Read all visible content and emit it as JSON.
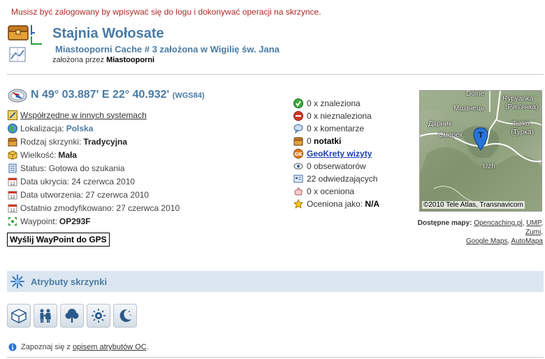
{
  "notice": "Musisz być zalogowany by wpisywać się do logu i dokonywać operacji na skrzynce.",
  "cache": {
    "title": "Stajnia Wołosate",
    "subtitle": "Miastooporni Cache # 3 założona w Wigilię św. Jana",
    "owner_prefix": "założona przez",
    "owner": "Miastooporni"
  },
  "coordinates": {
    "text": "N 49° 03.887' E 22° 40.932'",
    "datum": "(WGS84)"
  },
  "details": {
    "other_systems_link": "Współrzędne w innych systemach",
    "location_label": "Lokalizacja:",
    "location_value": "Polska",
    "type_label": "Rodzaj skrzynki:",
    "type_value": "Tradycyjna",
    "size_label": "Wielkość:",
    "size_value": "Mała",
    "status": "Status: Gotowa do szukania",
    "hidden": "Data ukrycia: 24 czerwca 2010",
    "created": "Data utworzenia: 27 czerwca 2010",
    "modified": "Ostatnio zmodyfikowano: 27 czerwca 2010",
    "waypoint_label": "Waypoint:",
    "waypoint_value": "OP293F",
    "gps_button": "Wyślij WayPoint do GPS"
  },
  "stats": {
    "found": "0 x znaleziona",
    "not_found": "0 x nieznaleziona",
    "comments": "0 x komentarze",
    "notes_count": "0",
    "notes_label": "notatki",
    "geokrety": "GeoKrety wizyty",
    "watchers": "0 obserwatorów",
    "visitors": "22 odwiedzających",
    "ratings": "0 x oceniona",
    "rated_as_label": "Oceniona jako:",
    "rated_as_value": "N/A"
  },
  "map": {
    "labels": {
      "dolne": "Dolne",
      "rypyanka": "Rypyanka",
      "rypianka": "(Рип'янка)",
      "mshanets": "Мшанець",
      "dvernik": "Дврник",
      "turka": "Turka",
      "turka_cyr": "(Турка)",
      "smerek": "Смерек",
      "uzh": "Uzh"
    },
    "marker_letter": "T",
    "credit": "©2010 Tele Atlas, Transnavicom",
    "available_label": "Dostępne mapy:",
    "links": [
      "Opencaching.pl",
      "UMP",
      "Zumi",
      "Google Maps",
      "AutoMapa"
    ]
  },
  "attributes": {
    "title": "Atrybuty skrzynki",
    "icons": [
      "box-attribute-icon",
      "family-attribute-icon",
      "tree-attribute-icon",
      "wellness-attribute-icon",
      "night-attribute-icon"
    ],
    "note_prefix": "Zapoznaj się z",
    "note_link": "opisem atrybutów OC",
    "note_suffix": "."
  },
  "colors": {
    "accent": "#4a7ba4",
    "notice": "#b02828",
    "link": "#1a3fb5",
    "attr_bar": "#dbe6f0"
  }
}
